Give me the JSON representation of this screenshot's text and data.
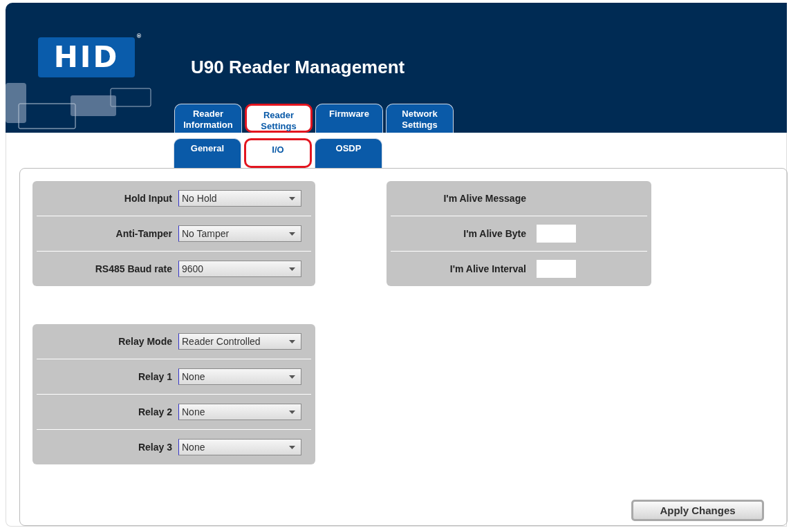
{
  "header": {
    "logo": "HID",
    "logo_mark": "®",
    "title": "U90 Reader Management"
  },
  "tabs": [
    {
      "label": "Reader Information",
      "selected": false
    },
    {
      "label": "Reader Settings",
      "selected": true
    },
    {
      "label": "Firmware",
      "selected": false
    },
    {
      "label": "Network Settings",
      "selected": false
    }
  ],
  "subtabs": [
    {
      "label": "General",
      "selected": false
    },
    {
      "label": "I/O",
      "selected": true
    },
    {
      "label": "OSDP",
      "selected": false
    }
  ],
  "io_groups": [
    {
      "rows": [
        {
          "label": "Hold Input",
          "value": "No Hold"
        },
        {
          "label": "Anti-Tamper",
          "value": "No Tamper"
        },
        {
          "label": "RS485 Baud rate",
          "value": "9600"
        }
      ]
    },
    {
      "rows": [
        {
          "label": "Relay Mode",
          "value": "Reader Controlled"
        },
        {
          "label": "Relay 1",
          "value": "None"
        },
        {
          "label": "Relay 2",
          "value": "None"
        },
        {
          "label": "Relay 3",
          "value": "None"
        }
      ]
    }
  ],
  "alive_group": {
    "rows": [
      {
        "label": "I'm Alive Message",
        "kind": "heading"
      },
      {
        "label": "I'm Alive Byte",
        "kind": "input"
      },
      {
        "label": "I'm Alive Interval",
        "kind": "input"
      }
    ]
  },
  "apply_button": "Apply Changes"
}
